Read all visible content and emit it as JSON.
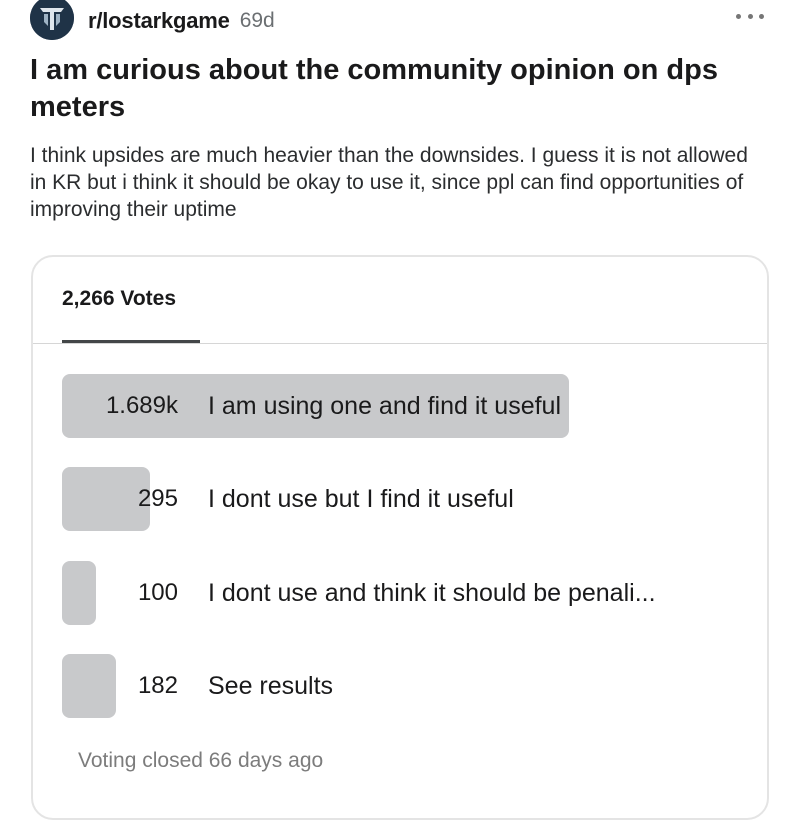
{
  "post": {
    "subreddit": "r/lostarkgame",
    "age": "69d",
    "title": "I am curious about the community opinion on dps meters",
    "body": "I think upsides are much heavier than the downsides. I guess it is not allowed in KR but i think it should be okay to use it, since ppl can find opportunities of improving their uptime"
  },
  "poll": {
    "votes_label": "2,266 Votes",
    "options": [
      {
        "count": "1.689k",
        "label": "I am using one and find it useful",
        "fraction": 0.745
      },
      {
        "count": "295",
        "label": "I dont use but I find it useful",
        "fraction": 0.13
      },
      {
        "count": "100",
        "label": "I dont use and think it should be penali...",
        "fraction": 0.044
      },
      {
        "count": "182",
        "label": "See results",
        "fraction": 0.08
      }
    ],
    "footer": "Voting closed 66 days ago"
  },
  "colors": {
    "bar": "#c8c9cb",
    "avatar": "#1f3347"
  },
  "icons": {
    "avatar": "lost-ark-logo-icon",
    "more": "more-options-icon"
  }
}
